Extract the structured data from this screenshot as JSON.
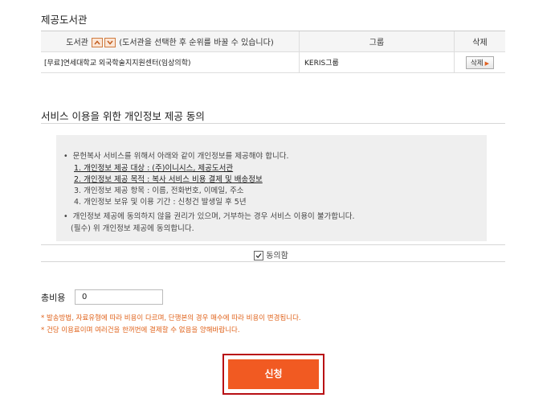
{
  "library_section": {
    "title": "제공도서관",
    "columns": {
      "library_prefix": "도서관",
      "library_hint": "(도서관을 선택한 후 순위를 바꿀 수 있습니다)",
      "group": "그룹",
      "delete": "삭제"
    },
    "rows": [
      {
        "library": "[무료]연세대학교 외국학술지지원센터(임상의학)",
        "group": "KERIS그룹",
        "delete_label": "삭제"
      }
    ],
    "icons": {
      "up": "arrow-up-icon",
      "down": "arrow-down-icon",
      "delete_arrow": "triangle-right-icon"
    }
  },
  "consent_section": {
    "title": "서비스 이용을 위한 개인정보 제공 동의",
    "bullet1": "문헌복사 서비스를 위해서 아래와 같이 개인정보를 제공해야 합니다.",
    "items": [
      "1. 개인정보 제공 대상 : (주)이니시스, 제공도서관",
      "2. 개인정보 제공 목적 : 복사 서비스 비용 결제 및 배송정보",
      "3. 개인정보 제공 항목 : 이름, 전화번호, 이메일, 주소",
      "4. 개인정보 보유 및 이용 기간 : 신청건 발생일 후 5년"
    ],
    "bullet2": "개인정보 제공에 동의하지 않을 권리가 있으며, 거부하는 경우 서비스 이용이 불가합니다.",
    "required_note": "(필수) 위 개인정보 제공에 동의합니다.",
    "agree_label": "동의함",
    "agree_checked": true
  },
  "total": {
    "label": "총비용",
    "value": "0"
  },
  "notices": [
    "* 발송방법, 자료유형에 따라 비용이 다르며, 단행본의 경우 매수에 따라 비용이 변경됩니다.",
    "* 건당 이용료이며 여러건을 한꺼번에 결제할 수 없음을 양해바랍니다."
  ],
  "submit_label": "신청",
  "colors": {
    "accent": "#f15a22",
    "highlight_border": "#b80f14",
    "notice": "#e0631c"
  }
}
